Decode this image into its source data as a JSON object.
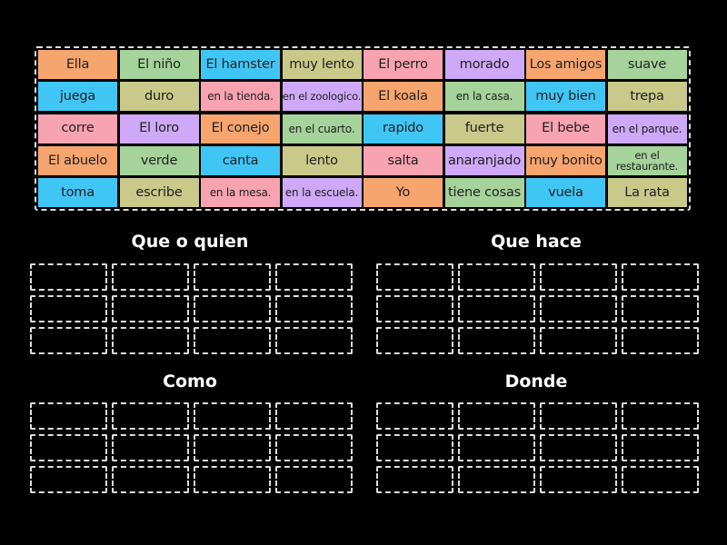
{
  "colors": {
    "orange": "#f6a56f",
    "green": "#a5d39b",
    "blue": "#40c6f5",
    "olive": "#c9c98a",
    "pink": "#f7a3b2",
    "purple": "#cfa9f8"
  },
  "tiles": [
    [
      {
        "t": "Ella",
        "c": "orange"
      },
      {
        "t": "El niño",
        "c": "green"
      },
      {
        "t": "El hamster",
        "c": "blue"
      },
      {
        "t": "muy lento",
        "c": "olive"
      },
      {
        "t": "El perro",
        "c": "pink"
      },
      {
        "t": "morado",
        "c": "purple"
      },
      {
        "t": "Los amigos",
        "c": "orange"
      },
      {
        "t": "suave",
        "c": "green"
      }
    ],
    [
      {
        "t": "juega",
        "c": "blue"
      },
      {
        "t": "duro",
        "c": "olive"
      },
      {
        "t": "en la tienda.",
        "c": "pink"
      },
      {
        "t": "en el zoologico.",
        "c": "purple"
      },
      {
        "t": "El koala",
        "c": "orange"
      },
      {
        "t": "en la casa.",
        "c": "green"
      },
      {
        "t": "muy bien",
        "c": "blue"
      },
      {
        "t": "trepa",
        "c": "olive"
      }
    ],
    [
      {
        "t": "corre",
        "c": "pink"
      },
      {
        "t": "El loro",
        "c": "purple"
      },
      {
        "t": "El conejo",
        "c": "orange"
      },
      {
        "t": "en el cuarto.",
        "c": "green"
      },
      {
        "t": "rapido",
        "c": "blue"
      },
      {
        "t": "fuerte",
        "c": "olive"
      },
      {
        "t": "El bebe",
        "c": "pink"
      },
      {
        "t": "en el parque.",
        "c": "purple"
      }
    ],
    [
      {
        "t": "El abuelo",
        "c": "orange"
      },
      {
        "t": "verde",
        "c": "green"
      },
      {
        "t": "canta",
        "c": "blue"
      },
      {
        "t": "lento",
        "c": "olive"
      },
      {
        "t": "salta",
        "c": "pink"
      },
      {
        "t": "anaranjado",
        "c": "purple"
      },
      {
        "t": "muy bonito",
        "c": "orange"
      },
      {
        "t": "en el restaurante.",
        "c": "green"
      }
    ],
    [
      {
        "t": "toma",
        "c": "blue"
      },
      {
        "t": "escribe",
        "c": "olive"
      },
      {
        "t": "en la mesa.",
        "c": "pink"
      },
      {
        "t": "en la escuela.",
        "c": "purple"
      },
      {
        "t": "Yo",
        "c": "orange"
      },
      {
        "t": "tiene cosas",
        "c": "green"
      },
      {
        "t": "vuela",
        "c": "blue"
      },
      {
        "t": "La rata",
        "c": "olive"
      }
    ]
  ],
  "groups": [
    "Que o quien",
    "Que hace",
    "Como",
    "Donde"
  ]
}
